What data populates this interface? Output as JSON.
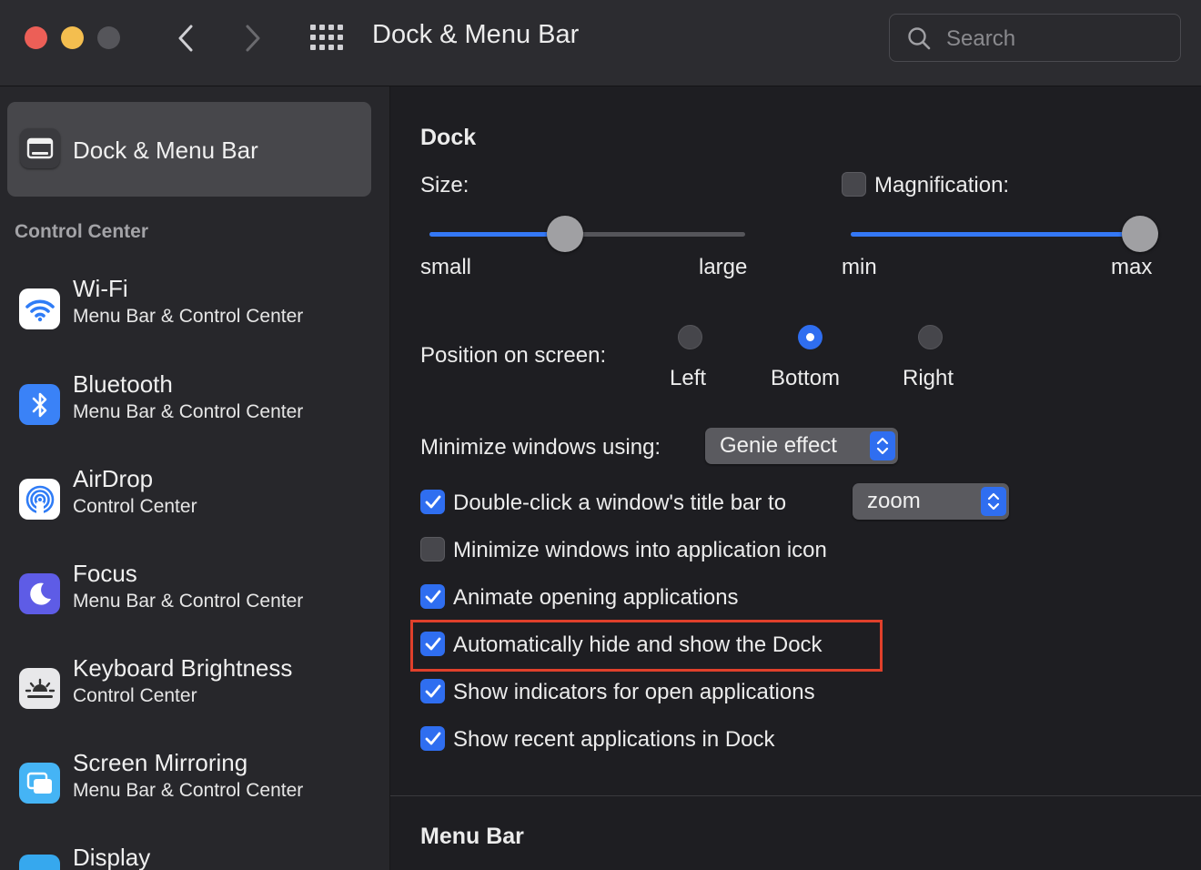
{
  "window": {
    "title": "Dock & Menu Bar",
    "search_placeholder": "Search"
  },
  "sidebar": {
    "selected": {
      "label": "Dock & Menu Bar",
      "icon": "dock-menubar-icon"
    },
    "section_title": "Control Center",
    "items": [
      {
        "name": "Wi-Fi",
        "sub": "Menu Bar & Control Center",
        "icon": "wifi-icon",
        "color": "#ffffff"
      },
      {
        "name": "Bluetooth",
        "sub": "Menu Bar & Control Center",
        "icon": "bluetooth-icon",
        "color": "#3a82f7"
      },
      {
        "name": "AirDrop",
        "sub": "Control Center",
        "icon": "airdrop-icon",
        "color": "#ffffff"
      },
      {
        "name": "Focus",
        "sub": "Menu Bar & Control Center",
        "icon": "moon-icon",
        "color": "#5e5ce6"
      },
      {
        "name": "Keyboard Brightness",
        "sub": "Control Center",
        "icon": "keyboard-brightness-icon",
        "color": "#e8e8ea"
      },
      {
        "name": "Screen Mirroring",
        "sub": "Menu Bar & Control Center",
        "icon": "screen-mirroring-icon",
        "color": "#45b4f5"
      },
      {
        "name": "Display",
        "sub": "",
        "icon": "display-icon",
        "color": "#36a8ee"
      }
    ]
  },
  "dock": {
    "heading": "Dock",
    "size": {
      "label": "Size:",
      "min_label": "small",
      "max_label": "large",
      "value": 0.43
    },
    "magnification": {
      "label": "Magnification:",
      "checked": false,
      "min_label": "min",
      "max_label": "max",
      "value": 1.0
    },
    "position": {
      "label": "Position on screen:",
      "options": [
        "Left",
        "Bottom",
        "Right"
      ],
      "selected": "Bottom"
    },
    "minimize_using": {
      "label": "Minimize windows using:",
      "value": "Genie effect"
    },
    "double_click": {
      "label": "Double-click a window's title bar to",
      "checked": true,
      "value": "zoom"
    },
    "checkboxes": [
      {
        "label": "Minimize windows into application icon",
        "checked": false
      },
      {
        "label": "Animate opening applications",
        "checked": true
      },
      {
        "label": "Automatically hide and show the Dock",
        "checked": true,
        "highlighted": true
      },
      {
        "label": "Show indicators for open applications",
        "checked": true
      },
      {
        "label": "Show recent applications in Dock",
        "checked": true
      }
    ]
  },
  "menu_bar": {
    "heading": "Menu Bar"
  },
  "colors": {
    "accent": "#2f6ef0",
    "highlight": "#e0402b"
  }
}
